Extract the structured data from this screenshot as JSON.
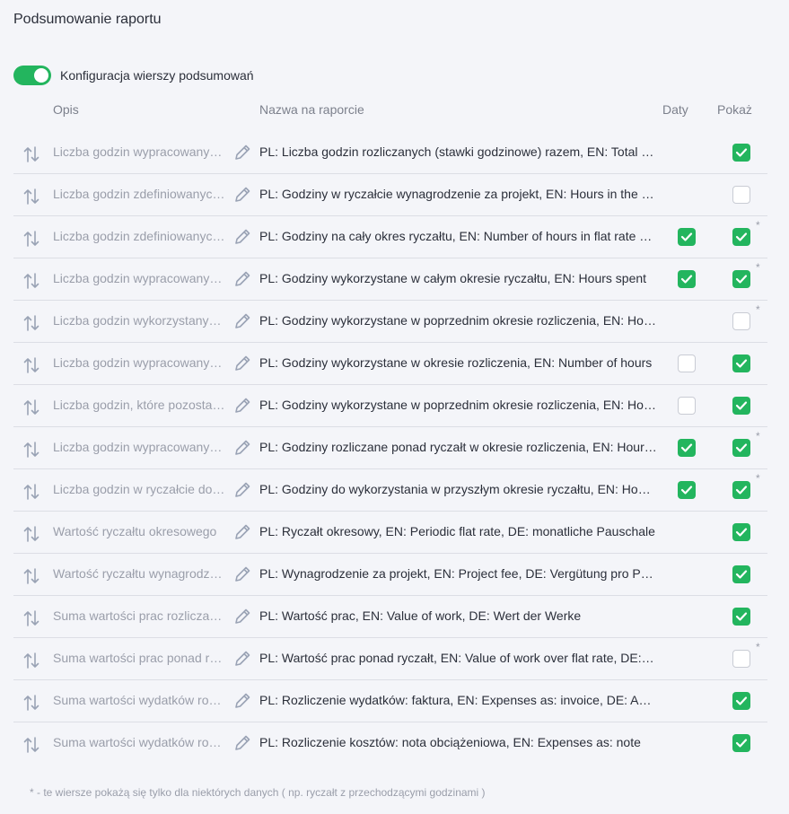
{
  "title": "Podsumowanie raportu",
  "toggle": {
    "label": "Konfiguracja wierszy podsumowań",
    "on": true
  },
  "headers": {
    "opis": "Opis",
    "nazwa": "Nazwa na raporcie",
    "daty": "Daty",
    "pokaz": "Pokaż"
  },
  "colors": {
    "accent": "#23b55e",
    "muted_text": "#9a9eaa",
    "icon": "#9aa3b5"
  },
  "rows": [
    {
      "opis": "Liczba godzin wypracowanych (stawki godzinowe) razem",
      "nazwa": "PL: Liczba godzin rozliczanych (stawki godzinowe) razem, EN: Total hours",
      "daty": null,
      "pokaz": true,
      "star": ""
    },
    {
      "opis": "Liczba godzin zdefiniowanych w ryczałcie wynagrodzenie za projekt",
      "nazwa": "PL: Godziny w ryczałcie wynagrodzenie za projekt, EN: Hours in the flat rate",
      "daty": null,
      "pokaz": false,
      "star": ""
    },
    {
      "opis": "Liczba godzin zdefiniowanych na cały okres ryczałtu",
      "nazwa": "PL: Godziny na cały okres ryczałtu, EN: Number of hours in flat rate period",
      "daty": true,
      "pokaz": true,
      "star": "*"
    },
    {
      "opis": "Liczba godzin wypracowanych w całym okresie ryczałtu",
      "nazwa": "PL: Godziny wykorzystane w całym okresie ryczałtu, EN: Hours spent",
      "daty": true,
      "pokaz": true,
      "star": "*"
    },
    {
      "opis": "Liczba godzin wykorzystanych w poprzednim okresie",
      "nazwa": "PL: Godziny wykorzystane w poprzednim okresie rozliczenia, EN: Hours used",
      "daty": null,
      "pokaz": false,
      "star": "*"
    },
    {
      "opis": "Liczba godzin wypracowanych w okresie rozliczenia",
      "nazwa": "PL: Godziny wykorzystane w okresie rozliczenia, EN: Number of hours",
      "daty": false,
      "pokaz": true,
      "star": ""
    },
    {
      "opis": "Liczba godzin, które pozostały z poprzedniego okresu",
      "nazwa": "PL: Godziny wykorzystane w poprzednim okresie rozliczenia, EN: Hours used",
      "daty": false,
      "pokaz": true,
      "star": ""
    },
    {
      "opis": "Liczba godzin wypracowanych ponad ryczałt",
      "nazwa": "PL: Godziny rozliczane ponad ryczałt w okresie rozliczenia, EN: Hours over",
      "daty": true,
      "pokaz": true,
      "star": "*"
    },
    {
      "opis": "Liczba godzin w ryczałcie do wykorzystania",
      "nazwa": "PL: Godziny do wykorzystania w przyszłym okresie ryczałtu, EN: Hours left",
      "daty": true,
      "pokaz": true,
      "star": "*"
    },
    {
      "opis": "Wartość ryczałtu okresowego",
      "nazwa": "PL: Ryczałt okresowy, EN: Periodic flat rate, DE: monatliche Pauschale",
      "daty": null,
      "pokaz": true,
      "star": ""
    },
    {
      "opis": "Wartość ryczałtu wynagrodzenie za projekt",
      "nazwa": "PL: Wynagrodzenie za projekt, EN: Project fee, DE: Vergütung pro Projekt",
      "daty": null,
      "pokaz": true,
      "star": ""
    },
    {
      "opis": "Suma wartości prac rozliczanych",
      "nazwa": "PL: Wartość prac, EN: Value of work, DE: Wert der Werke",
      "daty": null,
      "pokaz": true,
      "star": ""
    },
    {
      "opis": "Suma wartości prac ponad ryczałt",
      "nazwa": "PL: Wartość prac ponad ryczałt, EN: Value of work over flat rate, DE: Wert",
      "daty": null,
      "pokaz": false,
      "star": "*"
    },
    {
      "opis": "Suma wartości wydatków rozliczanych fakturą",
      "nazwa": "PL: Rozliczenie wydatków: faktura, EN: Expenses as: invoice, DE: Ausgaben",
      "daty": null,
      "pokaz": true,
      "star": ""
    },
    {
      "opis": "Suma wartości wydatków rozliczanych notą",
      "nazwa": "PL: Rozliczenie kosztów: nota obciążeniowa, EN: Expenses as: note",
      "daty": null,
      "pokaz": true,
      "star": ""
    }
  ],
  "footnote": "* - te wiersze pokażą się tylko dla niektórych danych ( np. ryczałt z przechodzącymi godzinami )"
}
